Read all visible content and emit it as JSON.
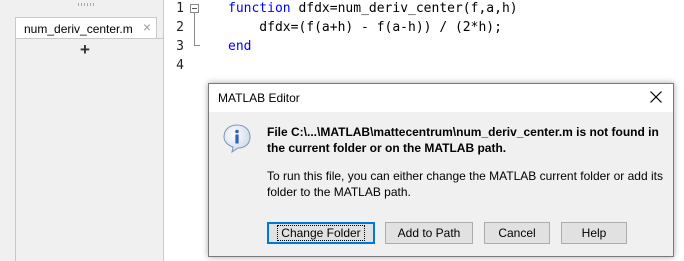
{
  "file_panel": {
    "tab_label": "num_deriv_center.m",
    "tab_close_glyph": "×",
    "add_tab_glyph": "+"
  },
  "editor": {
    "line_numbers": [
      "1",
      "2",
      "3",
      "4"
    ],
    "lines": [
      {
        "keyword": "function",
        "text": " dfdx=num_deriv_center(f,a,h)"
      },
      {
        "keyword": "",
        "text": "    dfdx=(f(a+h) - f(a-h)) / (2*h);"
      },
      {
        "keyword": "end",
        "text": ""
      },
      {
        "keyword": "",
        "text": ""
      }
    ],
    "keyword_color": "#0000ff"
  },
  "dialog": {
    "title": "MATLAB Editor",
    "icon": "info-icon",
    "message_bold": "File C:\\...\\MATLAB\\mattecentrum\\num_deriv_center.m is not found in the current folder or on the MATLAB path.",
    "message": "To run this file, you can either change the MATLAB current folder or add its folder to the MATLAB path.",
    "buttons": {
      "change_folder": "Change Folder",
      "add_to_path": "Add to Path",
      "cancel": "Cancel",
      "help": "Help"
    },
    "accent_color": "#0078d7"
  }
}
